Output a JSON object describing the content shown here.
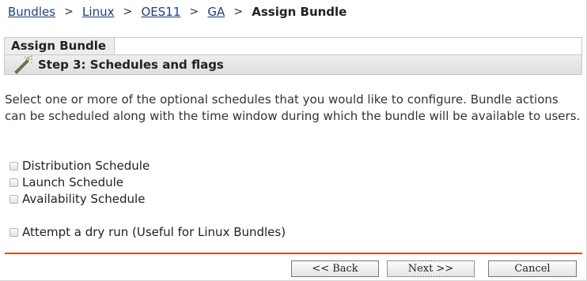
{
  "breadcrumb": {
    "links": [
      "Bundles",
      "Linux",
      "OES11",
      "GA"
    ],
    "separator": ">",
    "current": "Assign Bundle"
  },
  "panel": {
    "tab_title": "Assign Bundle",
    "step_icon": "wizard-wand-icon",
    "step_title": "Step 3: Schedules and flags"
  },
  "description": "Select one or more of the optional schedules that you would like to configure. Bundle actions can be scheduled along with the time window during which the bundle will be available to users.",
  "options": {
    "distribution": {
      "label": "Distribution Schedule",
      "checked": false
    },
    "launch": {
      "label": "Launch Schedule",
      "checked": false
    },
    "availability": {
      "label": "Availability Schedule",
      "checked": false
    },
    "dry_run": {
      "label": "Attempt a dry run (Useful for Linux Bundles)",
      "checked": false
    }
  },
  "buttons": {
    "back": "<< Back",
    "next": "Next >>",
    "cancel": "Cancel"
  },
  "colors": {
    "link": "#1f3f7a",
    "divider": "#c4552a",
    "step_bar": "#e6e6e6"
  }
}
